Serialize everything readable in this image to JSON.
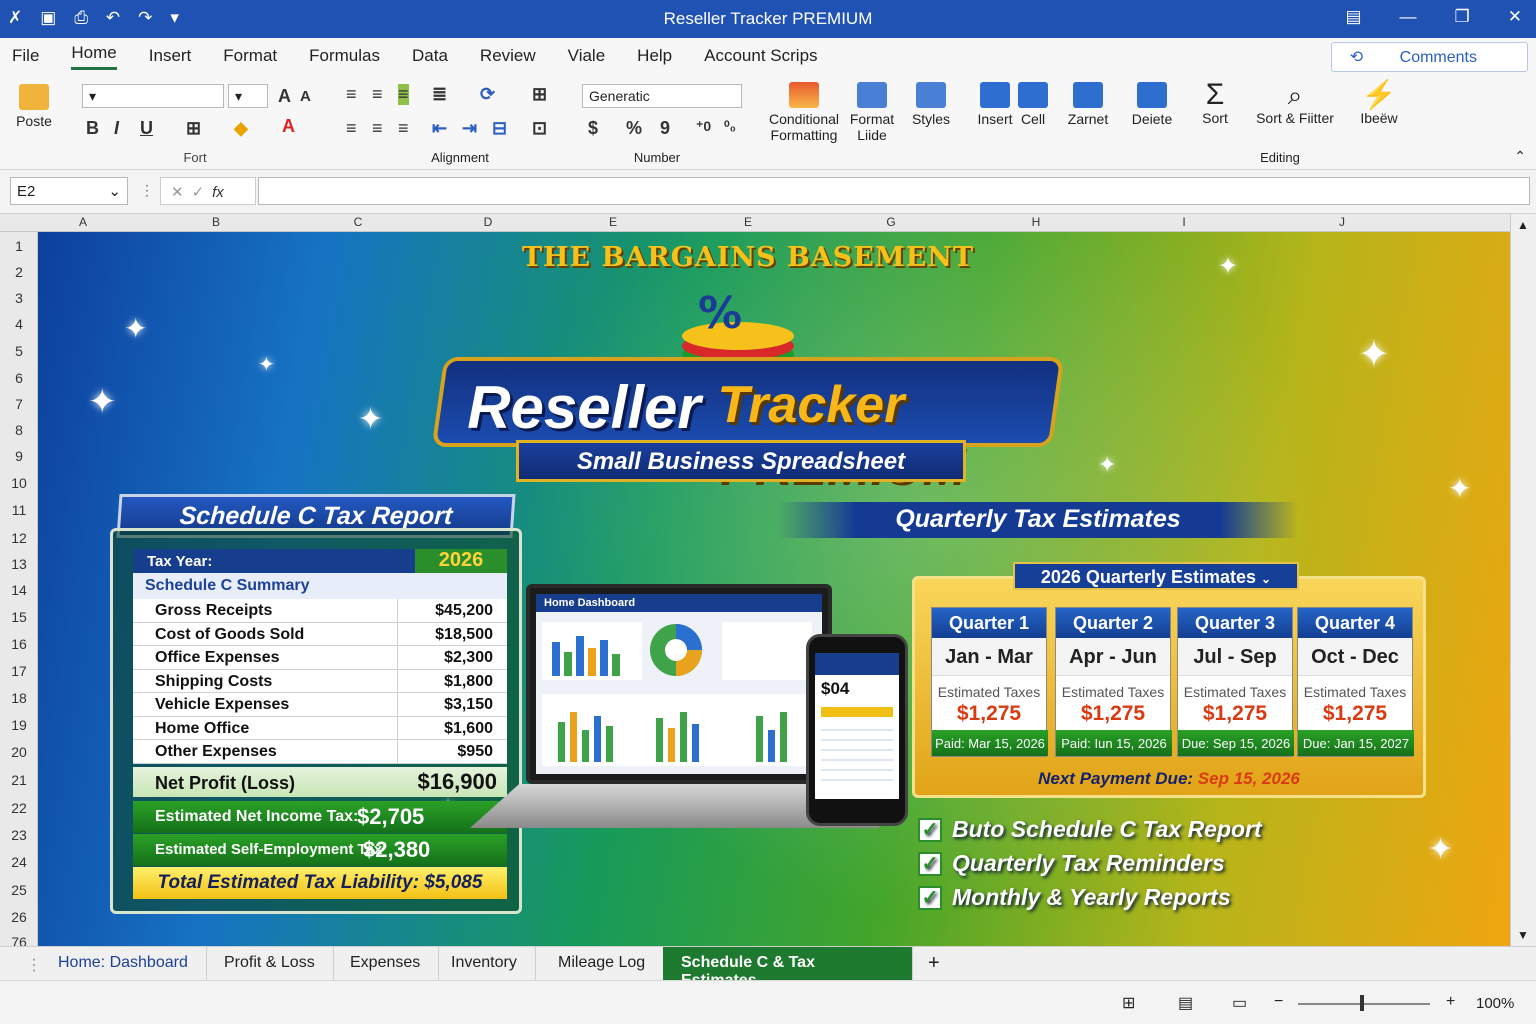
{
  "window": {
    "title": "Reseller Tracker PREMIUM"
  },
  "menu": [
    "File",
    "Home",
    "Insert",
    "Format",
    "Formulas",
    "Data",
    "Review",
    "Viale",
    "Help",
    "Account Scrips"
  ],
  "comments_label": "Comments",
  "ribbon": {
    "paste": "Poste",
    "font_group": "Fort",
    "alignment_group": "Alignment",
    "number_group": "Number",
    "number_format": "Generatic",
    "editing_group": "Editing",
    "conditional": "Conditional Formatting",
    "format_table": "Format Liide",
    "styles": "Styles",
    "insert": "Insert",
    "cell": "Cell",
    "zarnet": "Zarnet",
    "delete": "Deiete",
    "sort": "Sort",
    "sortfilter": "Sort & Fiitter",
    "ideas": "Ibeëw"
  },
  "formula": {
    "namebox": "E2",
    "fx": "fx"
  },
  "columns": [
    "A",
    "B",
    "C",
    "D",
    "E",
    "E",
    "G",
    "H",
    "I",
    "J"
  ],
  "rows": [
    "1",
    "2",
    "3",
    "4",
    "5",
    "6",
    "7",
    "8",
    "9",
    "10",
    "11",
    "12",
    "13",
    "14",
    "15",
    "16",
    "17",
    "18",
    "19",
    "20",
    "21",
    "22",
    "23",
    "24",
    "25",
    "26",
    "76"
  ],
  "banner": {
    "arch": "THE BARGAINS BASEMENT",
    "brand1": "Reseller",
    "brand2": "Tracker PREMIUM",
    "subtitle": "Small Business Spreadsheet"
  },
  "schedule": {
    "title": "Schedule C Tax Report",
    "tax_year_label": "Tax Year:",
    "tax_year": "2026",
    "summary_label": "Schedule C Summary",
    "items": [
      {
        "label": "Gross Receipts",
        "value": "$45,200"
      },
      {
        "label": "Cost of Goods Sold",
        "value": "$18,500"
      },
      {
        "label": "Office Expenses",
        "value": "$2,300"
      },
      {
        "label": "Shipping Costs",
        "value": "$1,800"
      },
      {
        "label": "Vehicle Expenses",
        "value": "$3,150"
      },
      {
        "label": "Home Office",
        "value": "$1,600"
      },
      {
        "label": "Other Expenses",
        "value": "$950"
      }
    ],
    "net_label": "Net Profit (Loss)",
    "net_value": "$16,900",
    "income_tax_label": "Estimated Net Income Tax:",
    "income_tax": "$2,705",
    "se_tax_label": "Estimated Self-Employment Tax",
    "se_tax": "$2,380",
    "total_label": "Total Estimated Tax Liability:",
    "total": "$5,085"
  },
  "devices": {
    "laptop_title": "Home Dashboard",
    "phone_value": "$04"
  },
  "quarterly": {
    "title": "Quarterly Tax Estimates",
    "subtitle": "2026 Quarterly Estimates",
    "quarters": [
      {
        "name": "Quarter 1",
        "months": "Jan - Mar",
        "label": "Estimated Taxes",
        "amount": "$1,275",
        "paid": "Paid: Mar 15, 2026"
      },
      {
        "name": "Quarter 2",
        "months": "Apr - Jun",
        "label": "Estimated Taxes",
        "amount": "$1,275",
        "paid": "Paid: Iun 15, 2026"
      },
      {
        "name": "Quarter 3",
        "months": "Jul - Sep",
        "label": "Estimated Taxes",
        "amount": "$1,275",
        "paid": "Due: Sep 15, 2026"
      },
      {
        "name": "Quarter 4",
        "months": "Oct - Dec",
        "label": "Estimated Taxes",
        "amount": "$1,275",
        "paid": "Due: Jan 15, 2027"
      }
    ],
    "next_label": "Next Payment Due:",
    "next_date": "Sep 15, 2026"
  },
  "features": [
    "Buto Schedule C Tax Report",
    "Quarterly Tax Reminders",
    "Monthly & Yearly Reports"
  ],
  "tabs": [
    "Home: Dashboard",
    "Profit & Loss",
    "Expenses",
    "Inventory",
    "Mileage Log",
    "Schedule C & Tax Estimates"
  ],
  "status": {
    "zoom": "100%"
  },
  "colors": {
    "titlebar": "#1f52b3",
    "active_tab": "#1e7a2e",
    "accent_orange": "#d83a12",
    "gold": "#f2c014"
  }
}
